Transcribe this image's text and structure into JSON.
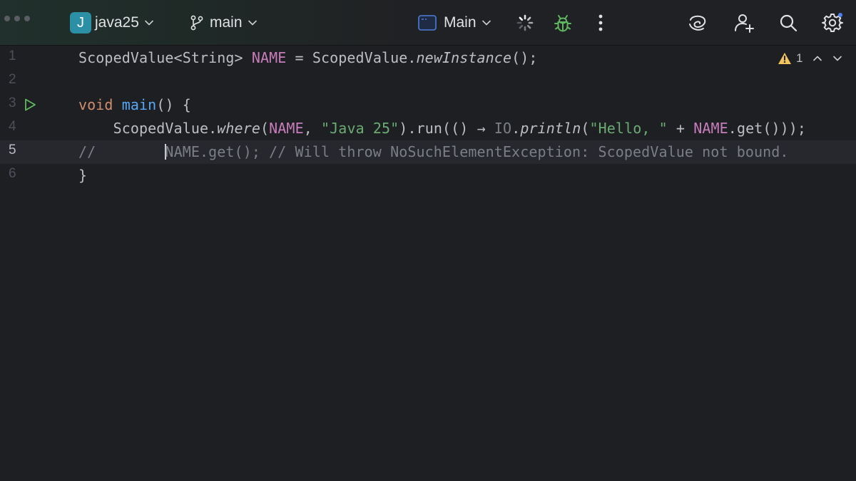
{
  "toolbar": {
    "project_initial": "J",
    "project_name": "java25",
    "branch_name": "main",
    "run_config": "Main",
    "icons": [
      "window-dots-icon",
      "chevron-down-icon",
      "git-branch-icon",
      "run-config-icon",
      "loading-spinner-icon",
      "debug-bug-icon",
      "more-vertical-icon",
      "ai-assistant-icon",
      "add-user-icon",
      "search-icon",
      "settings-gear-icon"
    ],
    "colors": {
      "project_badge": "#2b8fa6",
      "debug_icon": "#5fb85f",
      "notification_dot": "#4e7ff0"
    }
  },
  "editor": {
    "inspection": {
      "warning_count": "1",
      "warning_color": "#f2c55c"
    },
    "current_line": "5",
    "lines": [
      {
        "number": "1"
      },
      {
        "number": "2"
      },
      {
        "number": "3"
      },
      {
        "number": "4"
      },
      {
        "number": "5"
      },
      {
        "number": "6"
      }
    ],
    "line1": {
      "t1": "ScopedValue<String> ",
      "t2": "NAME",
      "t3": " = ScopedValue.",
      "t4": "newInstance",
      "t5": "();"
    },
    "line3": {
      "t1": "void",
      "t2": " ",
      "t3": "main",
      "t4": "() {"
    },
    "line4": {
      "t1": "    ScopedValue.",
      "t2": "where",
      "t3": "(",
      "t4": "NAME",
      "t5": ", ",
      "t6": "\"Java 25\"",
      "t7": ").run(() ",
      "t8": "→",
      "t9": " ",
      "t10": "IO",
      "t11": ".",
      "t12": "println",
      "t13": "(",
      "t14": "\"Hello, \"",
      "t15": " + ",
      "t16": "NAME",
      "t17": ".get()));"
    },
    "line5": {
      "t1": "//        ",
      "t2": "NAME.get(); // Will throw NoSuchElementException: ScopedValue not bound."
    },
    "line6": {
      "t1": "}"
    },
    "syntax_colors": {
      "keyword": "#cf8e6d",
      "function": "#56a8f5",
      "field": "#c77dbb",
      "string": "#6aab73",
      "comment": "#7a7e85",
      "text": "#bcbec4"
    }
  }
}
